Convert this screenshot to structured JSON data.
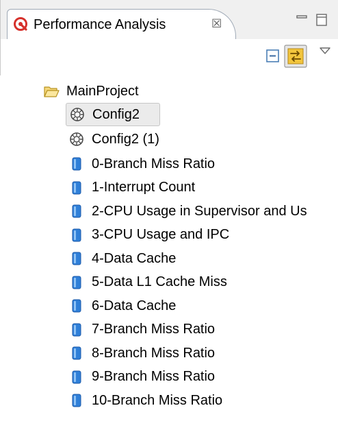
{
  "view": {
    "tab_title": "Performance Analysis",
    "tab_close": "☒"
  },
  "tree": {
    "root": "MainProject",
    "configs": [
      "Config2",
      "Config2 (1)"
    ],
    "items": [
      "0-Branch Miss Ratio",
      "1-Interrupt Count",
      "2-CPU Usage in Supervisor and Us",
      "3-CPU Usage and IPC",
      "4-Data Cache",
      "5-Data L1 Cache Miss",
      "6-Data Cache",
      "7-Branch Miss Ratio",
      "8-Branch Miss Ratio",
      "9-Branch Miss Ratio",
      "10-Branch Miss Ratio"
    ]
  },
  "colors": {
    "accent_red": "#d6302b",
    "db_blue": "#2f7fd8",
    "selection": "#ebebeb",
    "toggle_yellow": "#f2c53d"
  },
  "icons": {
    "tab": "performance-analysis-icon",
    "collapse": "collapse-all-icon",
    "link": "link-with-editor-icon",
    "menu": "view-menu-icon",
    "minimize": "minimize-icon",
    "maximize": "maximize-icon",
    "folder": "folder-open-icon",
    "config": "config-gear-icon",
    "data": "database-icon"
  }
}
